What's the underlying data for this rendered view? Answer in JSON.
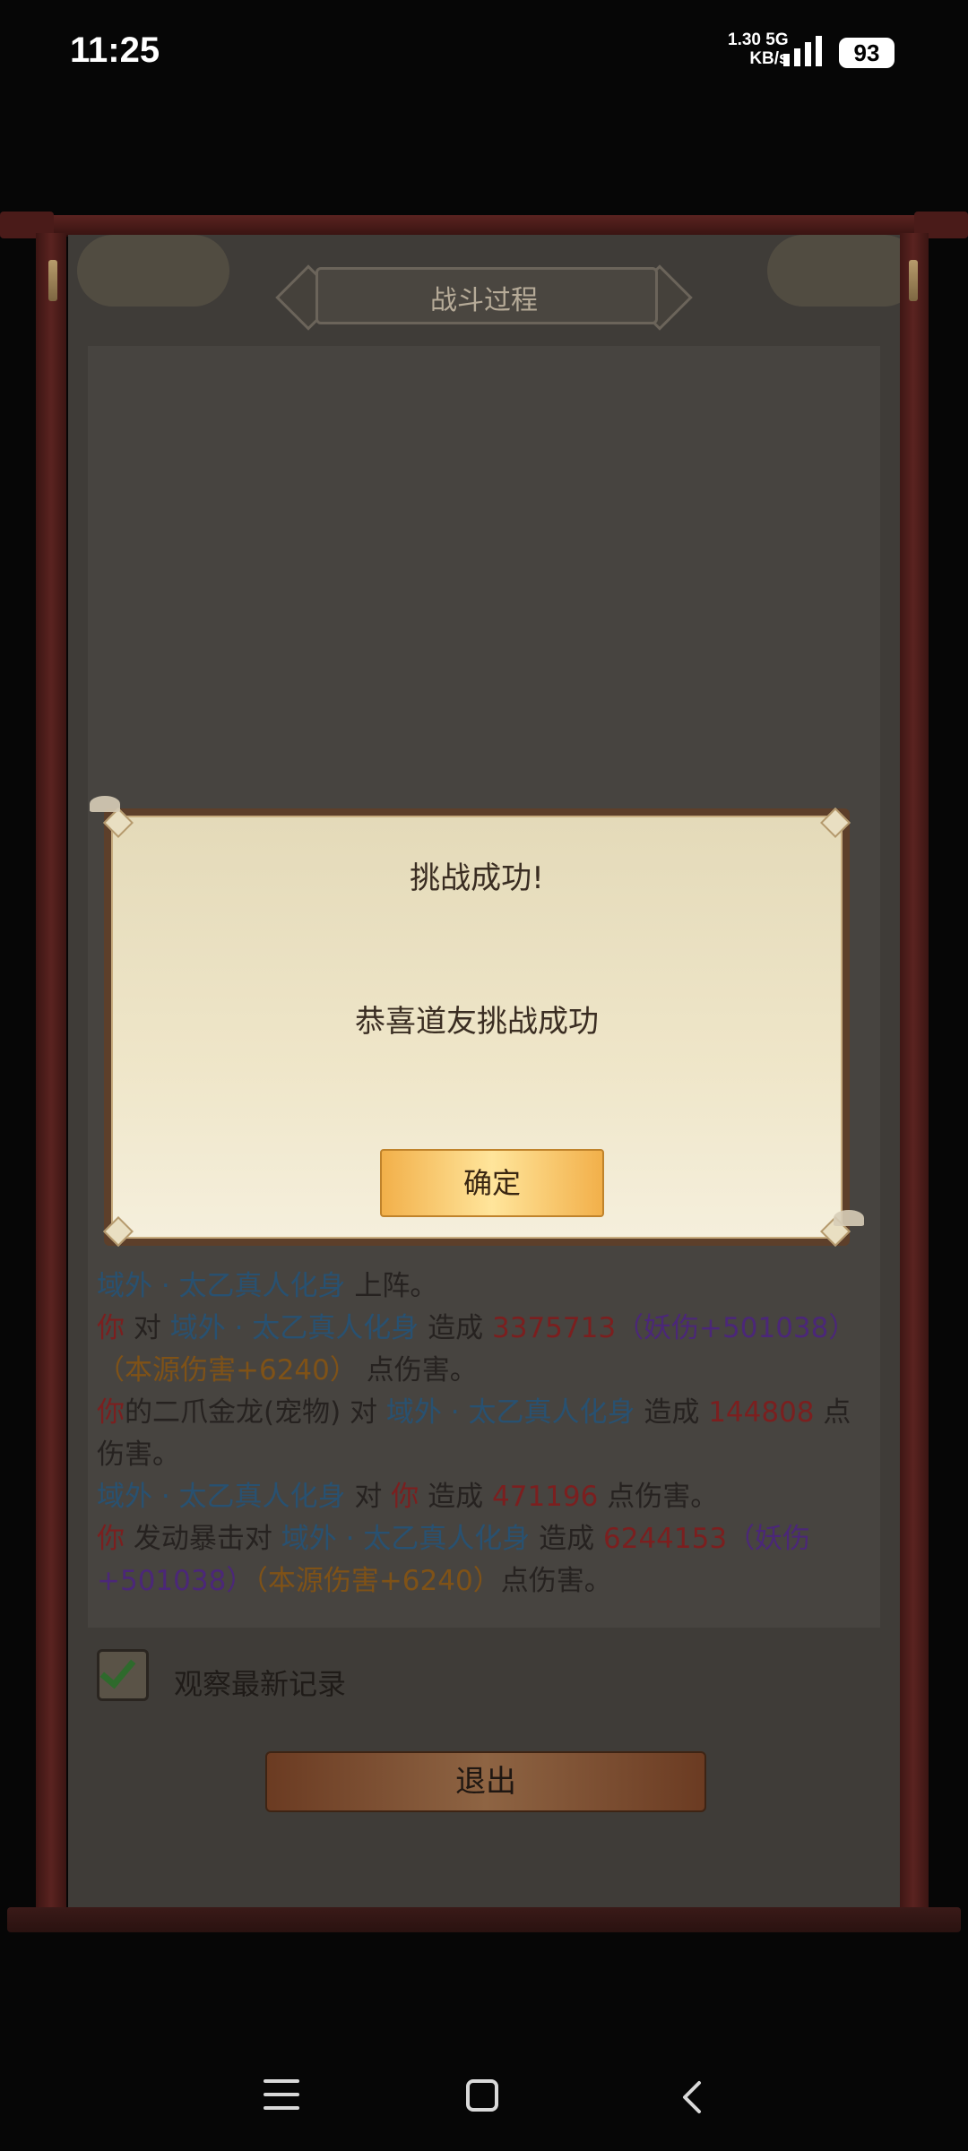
{
  "status_bar": {
    "time": "11:25",
    "net_speed": "1.30",
    "net_unit": "KB/s",
    "net_type": "5G",
    "battery": "93",
    "icons": [
      "signal-icon",
      "battery-icon"
    ]
  },
  "panel": {
    "title": "战斗过程",
    "log_lines": [
      [
        {
          "t": "域外 · 太乙真人化身",
          "c": "blue"
        },
        {
          "t": " 上阵。",
          "c": "plain"
        }
      ],
      [
        {
          "t": "你",
          "c": "red"
        },
        {
          "t": " 对 ",
          "c": "plain"
        },
        {
          "t": "域外 · 太乙真人化身",
          "c": "blue"
        },
        {
          "t": " 造成 ",
          "c": "plain"
        },
        {
          "t": "3375713",
          "c": "red"
        },
        {
          "t": "（妖伤+501038）",
          "c": "purple"
        },
        {
          "t": "（本源伤害+6240）",
          "c": "orange"
        },
        {
          "t": " 点伤害。",
          "c": "plain"
        }
      ],
      [
        {
          "t": "你",
          "c": "red"
        },
        {
          "t": "的二爪金龙(宠物) 对 ",
          "c": "plain"
        },
        {
          "t": "域外 · 太乙真人化身",
          "c": "blue"
        },
        {
          "t": " 造成 ",
          "c": "plain"
        },
        {
          "t": "144808",
          "c": "red"
        },
        {
          "t": " 点伤害。",
          "c": "plain"
        }
      ],
      [
        {
          "t": "域外 · 太乙真人化身",
          "c": "blue"
        },
        {
          "t": " 对 ",
          "c": "plain"
        },
        {
          "t": "你",
          "c": "red"
        },
        {
          "t": " 造成 ",
          "c": "plain"
        },
        {
          "t": "471196",
          "c": "red"
        },
        {
          "t": " 点伤害。",
          "c": "plain"
        }
      ],
      [
        {
          "t": "你",
          "c": "red"
        },
        {
          "t": " 发动暴击对 ",
          "c": "plain"
        },
        {
          "t": "域外 · 太乙真人化身",
          "c": "blue"
        },
        {
          "t": " 造成 ",
          "c": "plain"
        },
        {
          "t": "6244153",
          "c": "red"
        },
        {
          "t": "（妖伤+501038）",
          "c": "purple"
        },
        {
          "t": "（本源伤害+6240）",
          "c": "orange"
        },
        {
          "t": "点伤害。",
          "c": "plain"
        }
      ]
    ],
    "checkbox_label": "观察最新记录",
    "checkbox_checked": true,
    "exit_label": "退出"
  },
  "dialog": {
    "title": "挑战成功!",
    "message": "恭喜道友挑战成功",
    "ok_label": "确定"
  },
  "nav_bar": {
    "icons": [
      "menu-icon",
      "home-icon",
      "back-icon"
    ]
  }
}
